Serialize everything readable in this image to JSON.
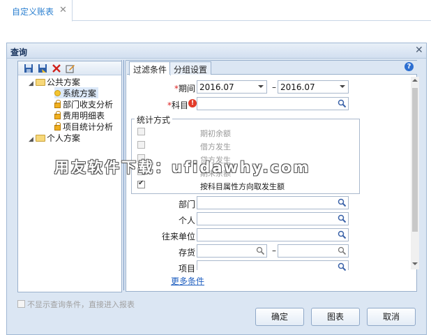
{
  "top_tab": {
    "label": "自定义账表",
    "close": "✕"
  },
  "dialog": {
    "title": "查询",
    "close": "✕",
    "tree": {
      "items": [
        {
          "label": "公共方案"
        },
        {
          "label": "系统方案"
        },
        {
          "label": "部门收支分析"
        },
        {
          "label": "费用明细表"
        },
        {
          "label": "项目统计分析"
        },
        {
          "label": "个人方案"
        }
      ]
    },
    "tabs": [
      {
        "label": "过滤条件"
      },
      {
        "label": "分组设置"
      }
    ],
    "help": "?",
    "form": {
      "period_label": "期间",
      "period_from": "2016.07",
      "period_sep": "–",
      "period_to": "2016.07",
      "subject_label": "科目",
      "stat_group_title": "统计方式",
      "options": [
        {
          "label": "期初余额",
          "checked": false
        },
        {
          "label": "借方发生",
          "checked": false
        },
        {
          "label": "贷方发生",
          "checked": false
        },
        {
          "label": "期末余额",
          "checked": false
        },
        {
          "label": "按科目属性方向取发生额",
          "checked": true
        }
      ],
      "department_label": "部门",
      "person_label": "个人",
      "contact_label": "往来单位",
      "inventory_label": "存货",
      "inventory_sep": "–",
      "project_label": "项目",
      "more_link": "更多条件"
    },
    "skip_dialog_label": "不显示查询条件，直接进入报表",
    "buttons": {
      "ok": "确定",
      "chart": "图表",
      "cancel": "取消"
    }
  },
  "watermark": "用友软件下载：ufidawhy.com"
}
